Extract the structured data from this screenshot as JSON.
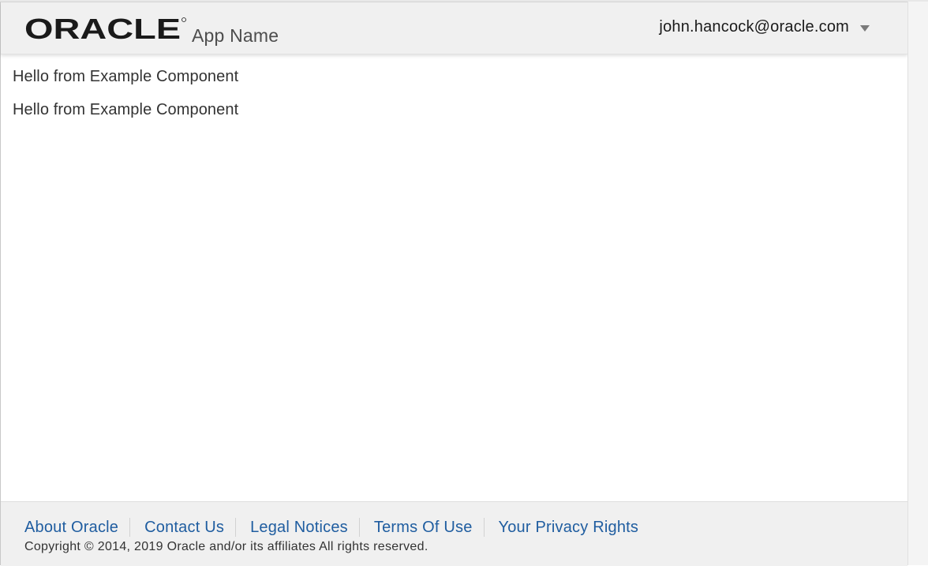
{
  "header": {
    "logo_text": "ORACLE",
    "app_name": "App Name",
    "user_email": "john.hancock@oracle.com"
  },
  "main": {
    "messages": [
      "Hello from Example Component",
      "Hello from Example Component"
    ]
  },
  "footer": {
    "links": [
      "About Oracle",
      "Contact Us",
      "Legal Notices",
      "Terms Of Use",
      "Your Privacy Rights"
    ],
    "copyright": "Copyright © 2014, 2019 Oracle and/or its affiliates All rights reserved."
  },
  "colors": {
    "header_bg": "#f0f0f0",
    "link": "#1f5da0",
    "text": "#333333"
  }
}
